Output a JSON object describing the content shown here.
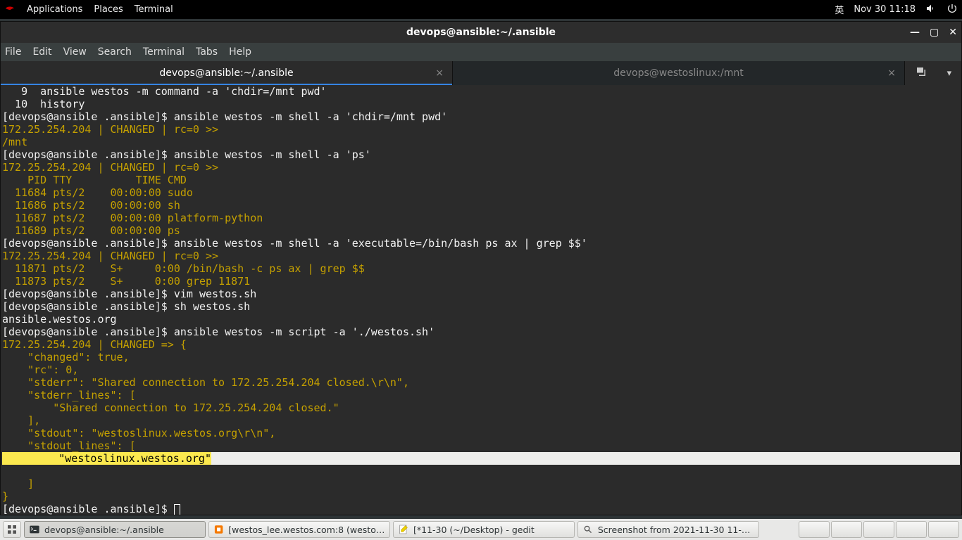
{
  "topbar": {
    "applications": "Applications",
    "places": "Places",
    "terminal": "Terminal",
    "ime": "英",
    "datetime": "Nov 30  11:18"
  },
  "window": {
    "title": "devops@ansible:~/.ansible",
    "menu": {
      "file": "File",
      "edit": "Edit",
      "view": "View",
      "search": "Search",
      "terminal": "Terminal",
      "tabs": "Tabs",
      "help": "Help"
    },
    "tab1": "devops@ansible:~/.ansible",
    "tab2": "devops@westoslinux:/mnt"
  },
  "term": {
    "l9": "   9  ansible westos -m command -a 'chdir=/mnt pwd'",
    "l10": "  10  history",
    "p1": "[devops@ansible .ansible]$ ",
    "c1": "ansible westos -m shell -a 'chdir=/mnt pwd'",
    "r1": "172.25.254.204 | CHANGED | rc=0 >>",
    "o1": "/mnt",
    "c2": "ansible westos -m shell -a 'ps'",
    "r2": "172.25.254.204 | CHANGED | rc=0 >>",
    "ps_hdr": "    PID TTY          TIME CMD",
    "ps1": "  11684 pts/2    00:00:00 sudo",
    "ps2": "  11686 pts/2    00:00:00 sh",
    "ps3": "  11687 pts/2    00:00:00 platform-python",
    "ps4": "  11689 pts/2    00:00:00 ps",
    "c3": "ansible westos -m shell -a 'executable=/bin/bash ps ax | grep $$'",
    "r3": "172.25.254.204 | CHANGED | rc=0 >>",
    "grep1": "  11871 pts/2    S+     0:00 /bin/bash -c ps ax | grep $$",
    "grep2": "  11873 pts/2    S+     0:00 grep 11871",
    "c4": "vim westos.sh",
    "c5": "sh westos.sh",
    "o5": "ansible.westos.org",
    "c6": "ansible westos -m script -a './westos.sh'",
    "r6": "172.25.254.204 | CHANGED => {",
    "j1": "    \"changed\": true,",
    "j2": "    \"rc\": 0,",
    "j3": "    \"stderr\": \"Shared connection to 172.25.254.204 closed.\\r\\n\",",
    "j4": "    \"stderr_lines\": [",
    "j5": "        \"Shared connection to 172.25.254.204 closed.\"",
    "j6": "    ],",
    "j7": "    \"stdout\": \"westoslinux.westos.org\\r\\n\",",
    "j8": "    \"stdout_lines\": [",
    "j9a": "        \"westoslinux.westos.org\"",
    "j10": "    ]",
    "j11": "}"
  },
  "taskbar": {
    "t1": "devops@ansible:~/.ansible",
    "t2": "[westos_lee.westos.com:8 (westos)…",
    "t3": "[*11-30 (~/Desktop) - gedit",
    "t4": "Screenshot from 2021-11-30 11-0…"
  }
}
